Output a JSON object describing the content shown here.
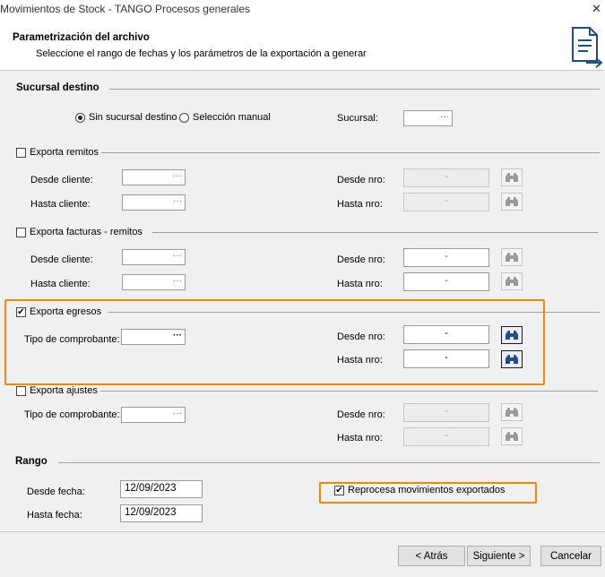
{
  "window": {
    "title": "Movimientos de Stock - TANGO Procesos generales",
    "close_glyph": "✕"
  },
  "header": {
    "title": "Parametrización del archivo",
    "subtitle": "Seleccione el rango de fechas y los parámetros de la exportación a generar",
    "icon": "export-document-icon"
  },
  "sucursal": {
    "section": "Sucursal destino",
    "opt_none": "Sin sucursal destino",
    "opt_manual": "Selección manual",
    "selected": "Sin sucursal destino",
    "label": "Sucursal:"
  },
  "remitos": {
    "check_label": "Exporta remitos",
    "checked": false,
    "desde_cliente": "Desde cliente:",
    "hasta_cliente": "Hasta cliente:",
    "desde_nro": "Desde nro:",
    "hasta_nro": "Hasta nro:",
    "desde_nro_value": "-",
    "hasta_nro_value": "-"
  },
  "facturas": {
    "check_label": "Exporta facturas - remitos",
    "checked": false,
    "desde_cliente": "Desde cliente:",
    "hasta_cliente": "Hasta cliente:",
    "desde_nro": "Desde nro:",
    "hasta_nro": "Hasta nro:",
    "desde_nro_value": "-",
    "hasta_nro_value": "-"
  },
  "egresos": {
    "check_label": "Exporta egresos",
    "checked": true,
    "tipo": "Tipo de comprobante:",
    "desde_nro": "Desde nro:",
    "hasta_nro": "Hasta nro:",
    "desde_nro_value": "-",
    "hasta_nro_value": "-"
  },
  "ajustes": {
    "check_label": "Exporta ajustes",
    "checked": false,
    "tipo": "Tipo de comprobante:",
    "desde_nro": "Desde nro:",
    "hasta_nro": "Hasta nro:",
    "desde_nro_value": "-",
    "hasta_nro_value": "-"
  },
  "rango": {
    "section": "Rango",
    "desde_label": "Desde fecha:",
    "desde_value": "12/09/2023",
    "hasta_label": "Hasta fecha:",
    "hasta_value": "12/09/2023",
    "reprocesa_label": "Reprocesa movimientos exportados",
    "reprocesa_checked": true
  },
  "lookup_glyph": "···",
  "check_glyph": "✔",
  "footer": {
    "back": "< Atrás",
    "next": "Siguiente >",
    "cancel": "Cancelar"
  },
  "colors": {
    "highlight": "#f08a00",
    "panel": "#f0f0f0",
    "icon_blue": "#1f4e8c"
  }
}
